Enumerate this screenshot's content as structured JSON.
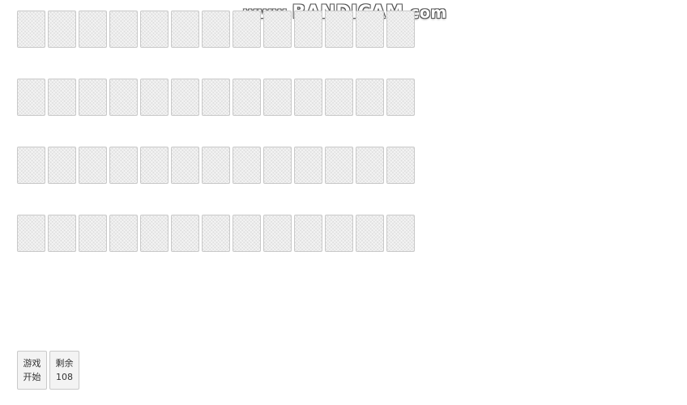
{
  "watermark": {
    "prefix": "www.",
    "brand": "BANDICAM",
    "suffix": ".com"
  },
  "board": {
    "rows": 4,
    "cards_per_row": 13,
    "card_face": "face-down"
  },
  "controls": {
    "start_button": {
      "line1": "游戏",
      "line2": "开始"
    },
    "remaining": {
      "label": "剩余",
      "count": "108"
    }
  }
}
